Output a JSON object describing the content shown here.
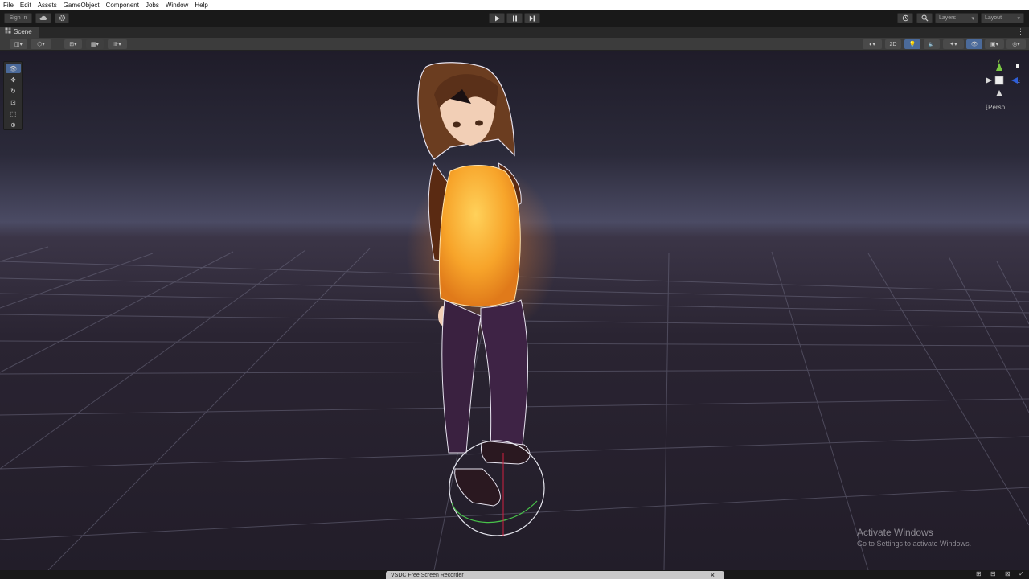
{
  "menu": [
    "File",
    "Edit",
    "Assets",
    "GameObject",
    "Component",
    "Jobs",
    "Window",
    "Help"
  ],
  "toolbar": {
    "sign_in": "Sign In",
    "play_icon": "play-icon",
    "pause_icon": "pause-icon",
    "step_icon": "step-icon",
    "layers_label": "Layers",
    "layout_label": "Layout"
  },
  "scene_tab": {
    "label": "Scene"
  },
  "scene_toolbar": {
    "mode_2d": "2D"
  },
  "tools": [
    "view-tool-icon",
    "move-tool-icon",
    "rotate-tool-icon",
    "scale-tool-icon",
    "rect-tool-icon",
    "transform-tool-icon"
  ],
  "gizmo": {
    "persp_label": "Persp",
    "y_axis": "y",
    "z_axis": "z"
  },
  "watermark": {
    "title": "Activate Windows",
    "subtitle": "Go to Settings to activate Windows."
  },
  "recorder": {
    "title": "VSDC Free Screen Recorder",
    "close": "×"
  },
  "colors": {
    "sky_top": "#1f1c29",
    "horizon": "#4a4a63",
    "floor": "#27212f",
    "grid": "#6c6a7f",
    "selection_outline": "#ffffff",
    "sweater": "#f7a42a",
    "hair": "#6b3d20"
  }
}
